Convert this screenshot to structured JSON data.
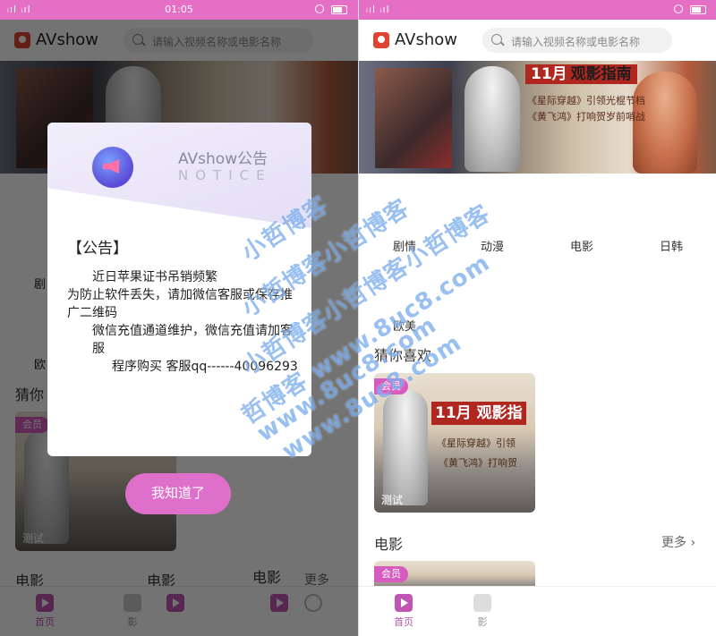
{
  "status_bar_left": {
    "signal": "ᵢıl ᵢıl",
    "time": "01:05"
  },
  "status_bar_right": {
    "signal": "ᵢıl ᵢıl"
  },
  "app": {
    "name": "AVshow",
    "search_placeholder": "请输入视频名称或电影名称"
  },
  "banner": {
    "heading_a": "11月",
    "heading_b": "观影指南",
    "line1": "《星际穿越》引领光棍节档",
    "line2": "《黄飞鸿》打响贺岁前哨战"
  },
  "categories": {
    "row1": [
      "剧情",
      "动漫",
      "电影",
      "日韩"
    ],
    "row2": [
      "欧美"
    ]
  },
  "sections": {
    "guess": "猜你喜欢",
    "movies": "电影",
    "more": "更多"
  },
  "card": {
    "badge": "会员",
    "cover_head": "11月 观影指",
    "cover_sub": "《星际穿越》引领",
    "cover_sub2": "《黄飞鸿》打响贺",
    "caption": "测试"
  },
  "tabbar": {
    "home": "首页",
    "tab2": "影",
    "tab3": "",
    "tab4": ""
  },
  "left_bg": {
    "movie_labels": [
      "电影",
      "电影",
      "电影"
    ],
    "more": "更多",
    "cat_fragment_1": "剧",
    "cat_fragment_2": "欧",
    "guess_fragment": "猜你",
    "tabs": [
      "首页",
      "影"
    ]
  },
  "dialog": {
    "title": "AVshow公告",
    "subtitle": "NOTICE",
    "head": "【公告】",
    "lines": [
      "近日苹果证书吊销频繁",
      "为防止软件丢失，请加微信客服或保存推广二维码",
      "微信充值通道维护，微信充值请加客服",
      "程序购买 客服qq------40096293"
    ],
    "button": "我知道了"
  },
  "watermark": {
    "line_a": "小哲博客",
    "line_b": "小哲博客小哲博客",
    "line_c": "小哲博客小哲博客小哲博客",
    "line_d": "哲博客 www.8uc8.com",
    "line_e": "www.8uc8.com",
    "line_f": "www.8uc8.com"
  },
  "colors": {
    "accent": "#de6fca",
    "badge": "#d65bbf",
    "status": "#e46fc5"
  }
}
